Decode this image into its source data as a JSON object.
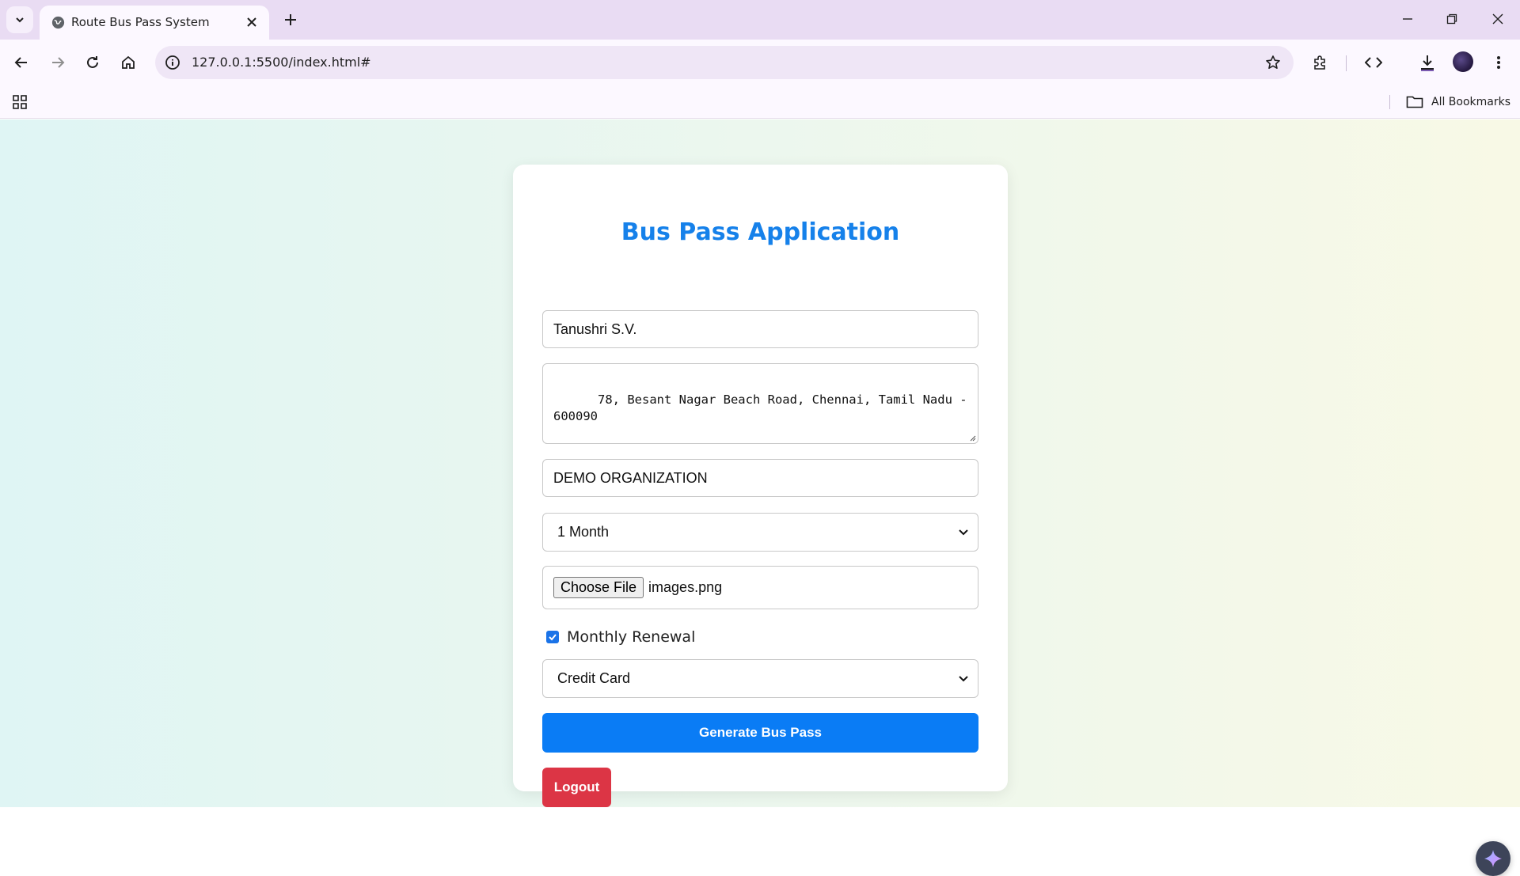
{
  "browser": {
    "tab_title": "Route Bus Pass System",
    "url": "127.0.0.1:5500/index.html#",
    "bookmarks_label": "All Bookmarks"
  },
  "form": {
    "title": "Bus Pass Application",
    "name_value": "Tanushri S.V.",
    "address_value": "78, Besant Nagar Beach Road, Chennai, Tamil Nadu - 600090",
    "organization_value": "DEMO ORGANIZATION",
    "duration_selected": "1 Month",
    "file_button_label": "Choose File",
    "file_name": "images.png",
    "monthly_renewal_label": "Monthly Renewal",
    "monthly_renewal_checked": true,
    "payment_selected": "Credit Card",
    "generate_label": "Generate Bus Pass",
    "logout_label": "Logout"
  },
  "colors": {
    "title": "#1681ea",
    "primary_button": "#0a7cf5",
    "logout_button": "#dc3545"
  }
}
